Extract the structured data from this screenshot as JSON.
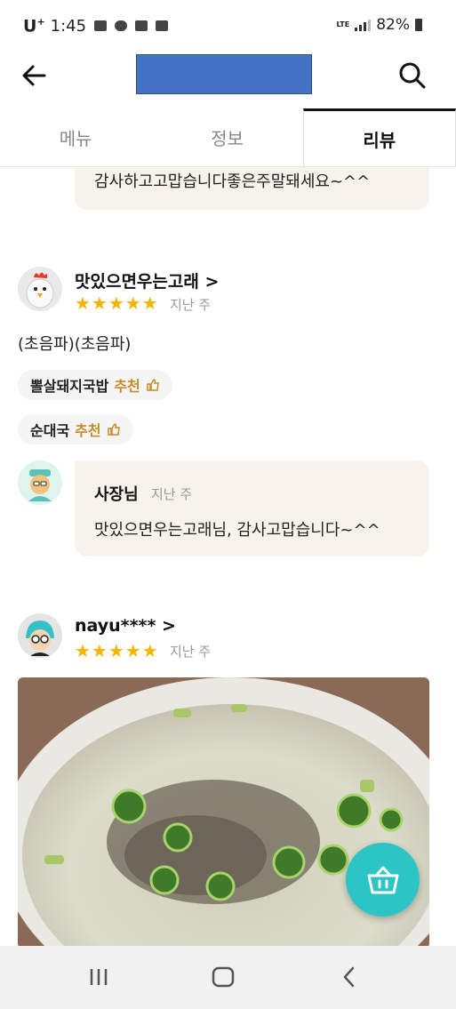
{
  "status_bar": {
    "carrier": "U",
    "carrier_sup": "+",
    "time": "1:45",
    "network": "LTE",
    "battery": "82%"
  },
  "tabs": [
    {
      "label": "메뉴",
      "active": false
    },
    {
      "label": "정보",
      "active": false
    },
    {
      "label": "리뷰",
      "active": true
    }
  ],
  "reviews": {
    "prev_reply": {
      "text": "감사하고고맙습니다좋은주말돼세요~^^"
    },
    "review1": {
      "user": "맛있으면우는고래",
      "user_chevron": ">",
      "stars": "★★★★★",
      "rating": 5,
      "date": "지난 주",
      "text": "(초음파)(초음파)",
      "menu_tags": [
        {
          "name": "뽈살돼지국밥",
          "rec": "추천"
        },
        {
          "name": "순대국",
          "rec": "추천"
        }
      ],
      "owner_reply": {
        "name": "사장님",
        "date": "지난 주",
        "text": "맛있으면우는고래님, 감사고맙습니다~^^"
      }
    },
    "review2": {
      "user": "nayu****",
      "user_chevron": ">",
      "stars": "★★★★★",
      "rating": 5,
      "date": "지난 주"
    }
  },
  "colors": {
    "accent_star": "#f5b400",
    "fab": "#2cc4c4",
    "title_block": "#4472c4",
    "bubble": "#f7f3eb",
    "recommend": "#c98a2a"
  },
  "icons": {
    "back": "arrow-left-icon",
    "search": "search-icon",
    "fab": "basket-icon",
    "thumb": "thumbs-up-icon",
    "nav_recent": "recent-apps-icon",
    "nav_home": "home-icon",
    "nav_back": "chevron-left-icon"
  }
}
